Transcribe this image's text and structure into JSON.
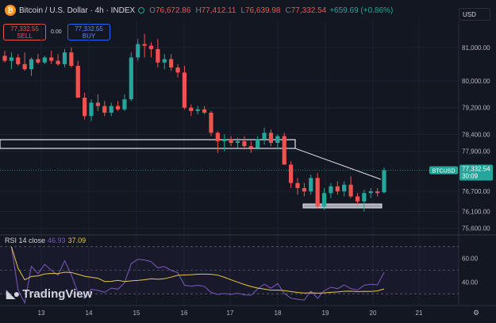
{
  "header": {
    "title": "Bitcoin / U.S. Dollar · 4h · INDEX",
    "open_label": "O",
    "open": "76,672.86",
    "high_label": "H",
    "high": "77,412.11",
    "low_label": "L",
    "low": "76,639.98",
    "close_label": "C",
    "close": "77,332.54",
    "change": "+659.69 (+0.86%)"
  },
  "trade": {
    "sell_price": "77,332.55",
    "sell_label": "SELL",
    "spread": "0.00",
    "buy_price": "77,332.55",
    "buy_label": "BUY"
  },
  "currency": "USD",
  "price_tag": {
    "symbol": "BTCUSD",
    "price": "77,332.54",
    "countdown": "30:09"
  },
  "rsi": {
    "label": "RSI 14 close",
    "value": "46.93",
    "ma_value": "37.09",
    "ticks": [
      "60.00",
      "40.00"
    ]
  },
  "brand": {
    "name": "TradingView"
  },
  "colors": {
    "up": "#26a69a",
    "down": "#ef5350",
    "bg": "#131722",
    "rsi": "#7e57c2",
    "rsi_ma": "#e8c547"
  },
  "chart_data": {
    "type": "candlestick",
    "price_axis_ticks": [
      "81,000.00",
      "80,000.00",
      "79,200.00",
      "78,400.00",
      "77,900.00",
      "76,700.00",
      "76,100.00",
      "75,600.00"
    ],
    "x_tick_labels": [
      "13",
      "14",
      "15",
      "16",
      "17",
      "18",
      "19",
      "20",
      "21"
    ],
    "ylim": [
      75400,
      81800
    ],
    "candles": [
      {
        "o": 80750,
        "h": 80900,
        "l": 80550,
        "c": 80600
      },
      {
        "o": 80600,
        "h": 80850,
        "l": 80350,
        "c": 80700
      },
      {
        "o": 80700,
        "h": 80800,
        "l": 80450,
        "c": 80500
      },
      {
        "o": 80500,
        "h": 80850,
        "l": 80300,
        "c": 80350
      },
      {
        "o": 80350,
        "h": 80700,
        "l": 80150,
        "c": 80650
      },
      {
        "o": 80650,
        "h": 80800,
        "l": 80500,
        "c": 80550
      },
      {
        "o": 80550,
        "h": 80750,
        "l": 80500,
        "c": 80700
      },
      {
        "o": 80700,
        "h": 80900,
        "l": 80500,
        "c": 80600
      },
      {
        "o": 80600,
        "h": 80800,
        "l": 80450,
        "c": 80500
      },
      {
        "o": 80500,
        "h": 80950,
        "l": 80400,
        "c": 80850
      },
      {
        "o": 80850,
        "h": 81000,
        "l": 80400,
        "c": 80450
      },
      {
        "o": 80450,
        "h": 80600,
        "l": 79800,
        "c": 79500
      },
      {
        "o": 79500,
        "h": 79650,
        "l": 78850,
        "c": 78950
      },
      {
        "o": 78950,
        "h": 79450,
        "l": 78800,
        "c": 79350
      },
      {
        "o": 79350,
        "h": 79600,
        "l": 79100,
        "c": 79250
      },
      {
        "o": 79250,
        "h": 79400,
        "l": 78950,
        "c": 79050
      },
      {
        "o": 79050,
        "h": 79350,
        "l": 78950,
        "c": 79250
      },
      {
        "o": 79250,
        "h": 79400,
        "l": 79100,
        "c": 79150
      },
      {
        "o": 79150,
        "h": 79600,
        "l": 79100,
        "c": 79450
      },
      {
        "o": 79450,
        "h": 80850,
        "l": 79400,
        "c": 80700
      },
      {
        "o": 80700,
        "h": 81250,
        "l": 80600,
        "c": 81100
      },
      {
        "o": 81100,
        "h": 81400,
        "l": 80700,
        "c": 81050
      },
      {
        "o": 81050,
        "h": 81150,
        "l": 80700,
        "c": 80950
      },
      {
        "o": 80950,
        "h": 81250,
        "l": 80400,
        "c": 80550
      },
      {
        "o": 80550,
        "h": 80800,
        "l": 80350,
        "c": 80650
      },
      {
        "o": 80650,
        "h": 80800,
        "l": 80300,
        "c": 80400
      },
      {
        "o": 80400,
        "h": 80500,
        "l": 80100,
        "c": 80250
      },
      {
        "o": 80250,
        "h": 80450,
        "l": 79150,
        "c": 79200
      },
      {
        "o": 79200,
        "h": 79300,
        "l": 78950,
        "c": 79100
      },
      {
        "o": 79100,
        "h": 79250,
        "l": 79000,
        "c": 79150
      },
      {
        "o": 79150,
        "h": 79250,
        "l": 79000,
        "c": 79050
      },
      {
        "o": 79050,
        "h": 79100,
        "l": 78350,
        "c": 78450
      },
      {
        "o": 78450,
        "h": 78500,
        "l": 77850,
        "c": 78200
      },
      {
        "o": 78200,
        "h": 78400,
        "l": 77900,
        "c": 78250
      },
      {
        "o": 78250,
        "h": 78350,
        "l": 78050,
        "c": 78150
      },
      {
        "o": 78150,
        "h": 78300,
        "l": 78000,
        "c": 78200
      },
      {
        "o": 78200,
        "h": 78350,
        "l": 77950,
        "c": 78050
      },
      {
        "o": 78050,
        "h": 78200,
        "l": 77850,
        "c": 78000
      },
      {
        "o": 78000,
        "h": 78350,
        "l": 77950,
        "c": 78250
      },
      {
        "o": 78250,
        "h": 78600,
        "l": 78100,
        "c": 78450
      },
      {
        "o": 78450,
        "h": 78550,
        "l": 78050,
        "c": 78150
      },
      {
        "o": 78150,
        "h": 78400,
        "l": 77950,
        "c": 78350
      },
      {
        "o": 78350,
        "h": 78450,
        "l": 77550,
        "c": 77500
      },
      {
        "o": 77500,
        "h": 77600,
        "l": 76800,
        "c": 76950
      },
      {
        "o": 76950,
        "h": 77100,
        "l": 76600,
        "c": 76800
      },
      {
        "o": 76800,
        "h": 76950,
        "l": 76550,
        "c": 76700
      },
      {
        "o": 76700,
        "h": 77200,
        "l": 76600,
        "c": 77100
      },
      {
        "o": 77100,
        "h": 77250,
        "l": 76200,
        "c": 76250
      },
      {
        "o": 76250,
        "h": 76800,
        "l": 76150,
        "c": 76650
      },
      {
        "o": 76650,
        "h": 76950,
        "l": 76500,
        "c": 76850
      },
      {
        "o": 76850,
        "h": 77000,
        "l": 76600,
        "c": 76700
      },
      {
        "o": 76700,
        "h": 77000,
        "l": 76550,
        "c": 76900
      },
      {
        "o": 76900,
        "h": 77150,
        "l": 76500,
        "c": 76550
      },
      {
        "o": 76550,
        "h": 76650,
        "l": 76300,
        "c": 76400
      },
      {
        "o": 76400,
        "h": 76750,
        "l": 76100,
        "c": 76650
      },
      {
        "o": 76650,
        "h": 76800,
        "l": 76500,
        "c": 76700
      },
      {
        "o": 76700,
        "h": 76800,
        "l": 76550,
        "c": 76650
      },
      {
        "o": 76672.86,
        "h": 77412.11,
        "l": 76639.98,
        "c": 77332.54
      }
    ]
  }
}
